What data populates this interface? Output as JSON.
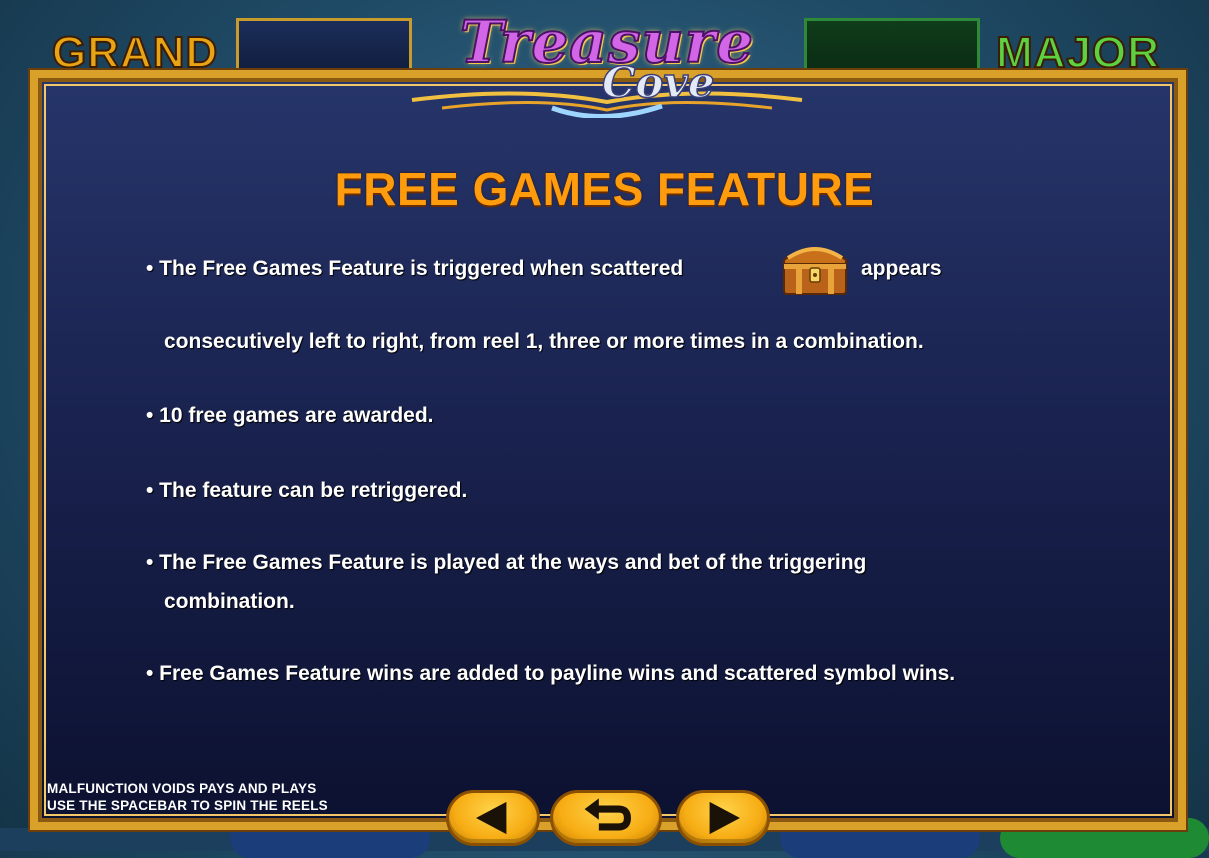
{
  "jackpots": {
    "grand_label": "GRAND",
    "major_label": "MAJOR"
  },
  "logo": {
    "line1": "Treasure",
    "line2": "Cove"
  },
  "heading": "FREE GAMES FEATURE",
  "rules": [
    {
      "line1": "• The Free Games Feature is triggered when scattered",
      "line1_after": "appears",
      "line2": "consecutively left to right, from reel 1, three or more times in a combination."
    },
    {
      "text": "• 10 free games are awarded."
    },
    {
      "text": "• The feature can be retriggered."
    },
    {
      "line1": "• The Free Games Feature is played at the ways and bet of the triggering",
      "line2": "combination."
    },
    {
      "text": "• Free Games Feature wins are added to payline wins and scattered symbol wins."
    }
  ],
  "scatter_symbol_icon": "treasure-chest-icon",
  "footer": {
    "line1": "MALFUNCTION VOIDS PAYS AND PLAYS",
    "line2": "USE THE SPACEBAR TO SPIN THE REELS"
  },
  "nav": {
    "prev_icon": "arrow-left-icon",
    "back_icon": "return-icon",
    "next_icon": "arrow-right-icon"
  },
  "colors": {
    "heading": "#ff9c0e",
    "panel_border": "#d9a12a",
    "panel_bg": "#1a2350",
    "button": "#f7ad14"
  }
}
